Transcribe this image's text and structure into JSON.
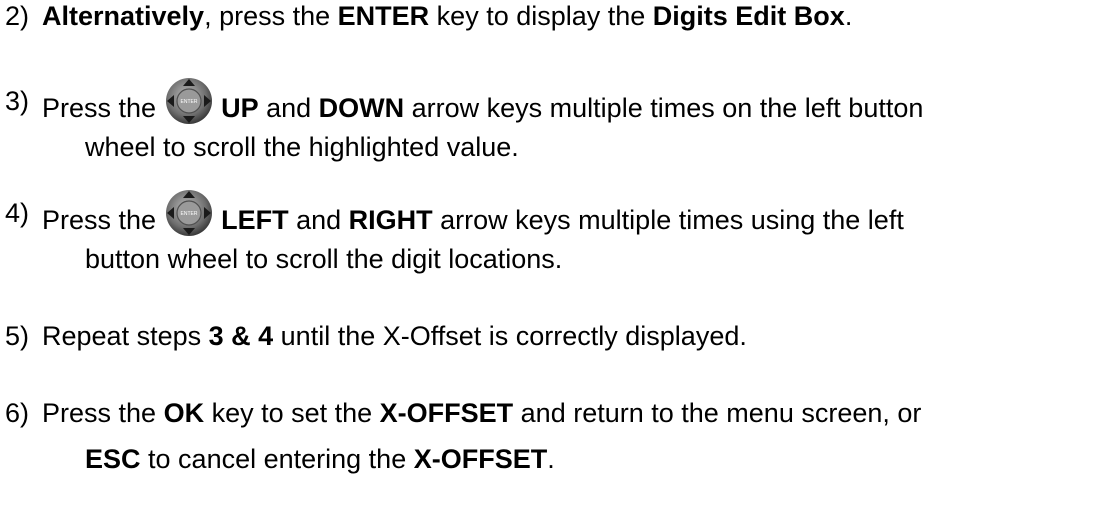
{
  "steps": [
    {
      "number": "2)",
      "lines": [
        [
          {
            "t": "Alternatively",
            "b": true
          },
          {
            "t": ", press the "
          },
          {
            "t": "ENTER",
            "b": true
          },
          {
            "t": " key to display the "
          },
          {
            "t": "Digits Edit Box",
            "b": true
          },
          {
            "t": "."
          }
        ]
      ]
    },
    {
      "number": "3)",
      "lines": [
        [
          {
            "t": " Press the "
          },
          {
            "icon": "button-wheel-icon"
          },
          {
            "t": " "
          },
          {
            "t": "UP",
            "b": true
          },
          {
            "t": " and "
          },
          {
            "t": "DOWN",
            "b": true
          },
          {
            "t": " arrow keys multiple times on the left button"
          }
        ],
        [
          {
            "t": "wheel to scroll the highlighted value."
          }
        ]
      ]
    },
    {
      "number": "4)",
      "lines": [
        [
          {
            "t": " Press the "
          },
          {
            "icon": "button-wheel-icon"
          },
          {
            "t": " "
          },
          {
            "t": "LEFT",
            "b": true
          },
          {
            "t": " and "
          },
          {
            "t": "RIGHT",
            "b": true
          },
          {
            "t": " arrow keys multiple times using the left"
          }
        ],
        [
          {
            "t": "button wheel to scroll the digit locations."
          }
        ]
      ]
    },
    {
      "number": "5)",
      "lines": [
        [
          {
            "t": " Repeat steps "
          },
          {
            "t": "3 & 4",
            "b": true
          },
          {
            "t": " until the X-Offset is correctly displayed."
          }
        ]
      ]
    },
    {
      "number": "6)",
      "lines": [
        [
          {
            "t": "Press the "
          },
          {
            "t": "OK",
            "b": true
          },
          {
            "t": " key to set the "
          },
          {
            "t": "X-OFFSET",
            "b": true
          },
          {
            "t": " and return to the menu screen, or"
          }
        ],
        [
          {
            "t": "ESC",
            "b": true
          },
          {
            "t": " to cancel entering the "
          },
          {
            "t": "X-OFFSET",
            "b": true
          },
          {
            "t": "."
          }
        ]
      ]
    }
  ],
  "icon_text": "ENTER"
}
